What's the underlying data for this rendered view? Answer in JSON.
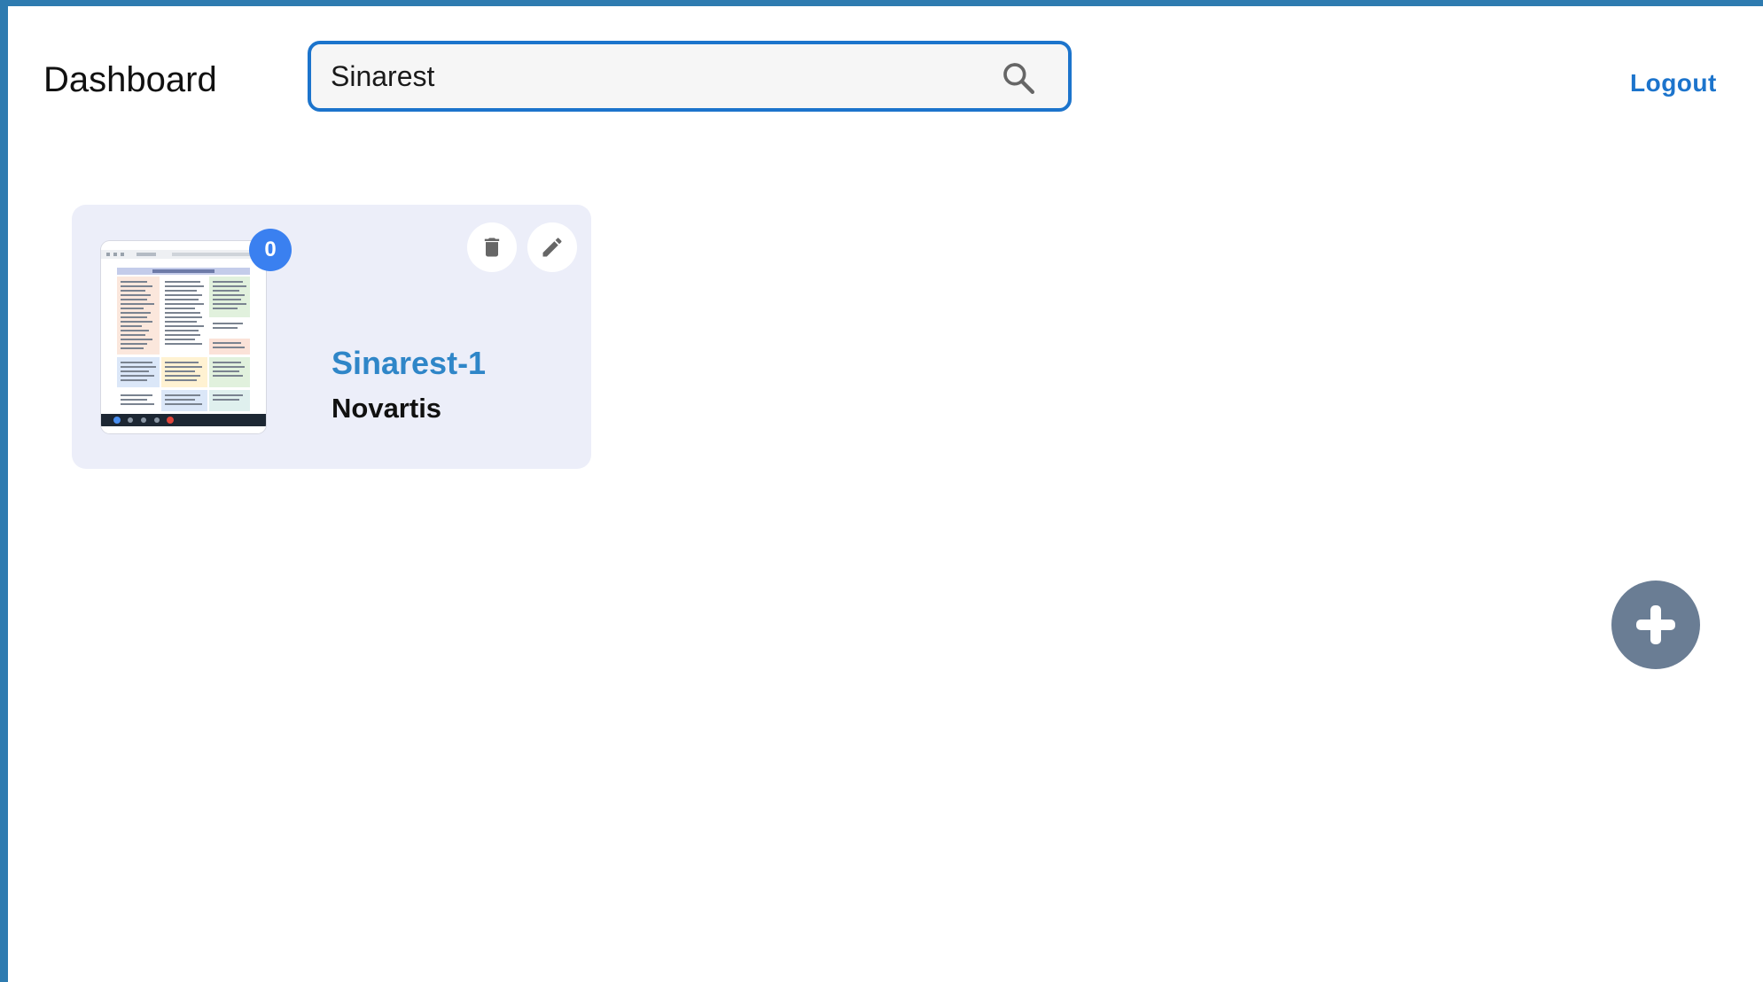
{
  "header": {
    "title": "Dashboard",
    "logout_label": "Logout"
  },
  "search": {
    "value": "Sinarest",
    "icon": "search-icon"
  },
  "projects": [
    {
      "name": "Sinarest-1",
      "client": "Novartis",
      "badge_count": "0",
      "thumbnail_icon": "document-thumbnail",
      "actions": [
        "trash-icon",
        "pencil-icon"
      ]
    }
  ],
  "fab": {
    "icon": "plus-icon"
  },
  "colors": {
    "accent": "#1c74cc",
    "project_name": "#2f86c8",
    "badge": "#3a80f0",
    "card_bg": "#eceef9",
    "fab_bg": "#6a7d94",
    "frame_border": "#2e7bb0"
  }
}
